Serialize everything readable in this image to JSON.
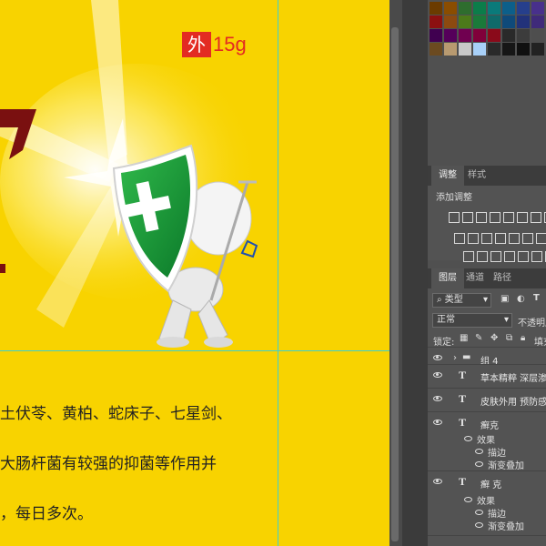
{
  "canvas": {
    "badge_char": "外",
    "weight": "15g",
    "body_lines": [
      "土伏苓、黄柏、蛇床子、七星剑、",
      "大肠杆菌有较强的抑菌等作用并",
      "，每日多次。"
    ]
  },
  "colors": {
    "canvas_bg": "#f8d300",
    "badge_red": "#e32b22",
    "guide": "#3fd0d0"
  },
  "adjustments_panel": {
    "tabs": [
      "调整",
      "样式"
    ],
    "title": "添加调整"
  },
  "layers_panel": {
    "tabs": [
      "图层",
      "通道",
      "路径"
    ],
    "filter_kind": "类型",
    "blend_mode": "正常",
    "opacity_label": "不透明度",
    "lock_label": "锁定:",
    "fill_label": "填充",
    "layers": [
      {
        "type": "group",
        "name": "组 4"
      },
      {
        "type": "text",
        "name": "草本精粹 深层渗透"
      },
      {
        "type": "text",
        "name": "皮肤外用  预防感染"
      },
      {
        "type": "text",
        "name": "癣克",
        "effects_label": "效果",
        "effects": [
          "描边",
          "渐变叠加"
        ]
      },
      {
        "type": "text",
        "name": "癣 克",
        "effects_label": "效果",
        "effects": [
          "描边",
          "渐变叠加"
        ]
      }
    ]
  }
}
